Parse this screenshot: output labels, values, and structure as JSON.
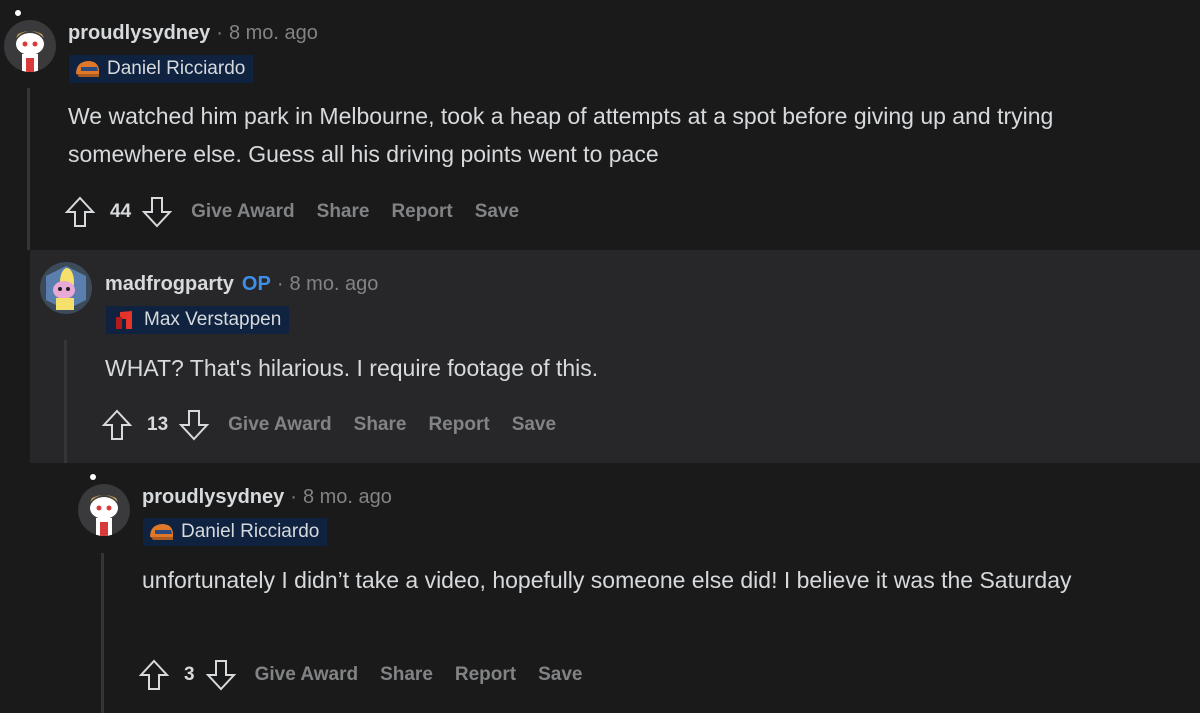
{
  "comments": [
    {
      "username": "proudlysydney",
      "separator": "·",
      "time": "8 mo. ago",
      "flair": "Daniel Ricciardo",
      "body": "We watched him park in Melbourne, took a heap of attempts at a spot before giving up and trying somewhere else. Guess all his driving points went to pace",
      "score": "44",
      "actions": [
        "Give Award",
        "Share",
        "Report",
        "Save"
      ]
    },
    {
      "username": "madfrogparty",
      "op_badge": "OP",
      "separator": "·",
      "time": "8 mo. ago",
      "flair": "Max Verstappen",
      "body": "WHAT? That's hilarious. I require footage of this.",
      "score": "13",
      "actions": [
        "Give Award",
        "Share",
        "Report",
        "Save"
      ]
    },
    {
      "username": "proudlysydney",
      "separator": "·",
      "time": "8 mo. ago",
      "flair": "Daniel Ricciardo",
      "body": "unfortunately I didn’t take a video, hopefully someone else did! I believe it was the Saturday",
      "score": "3",
      "actions": [
        "Give Award",
        "Share",
        "Report",
        "Save"
      ]
    }
  ],
  "colors": {
    "background": "#1a1a1b",
    "highlight": "#272729",
    "text": "#d7dadc",
    "muted": "#818384",
    "op": "#3d8ee8",
    "flair_bg": "#0f2240"
  },
  "icons": {
    "upvote": "arrow-up-outline-icon",
    "downvote": "arrow-down-outline-icon",
    "ricciardo_flair": "helmet-icon",
    "verstappen_flair": "red-flag-icon"
  }
}
